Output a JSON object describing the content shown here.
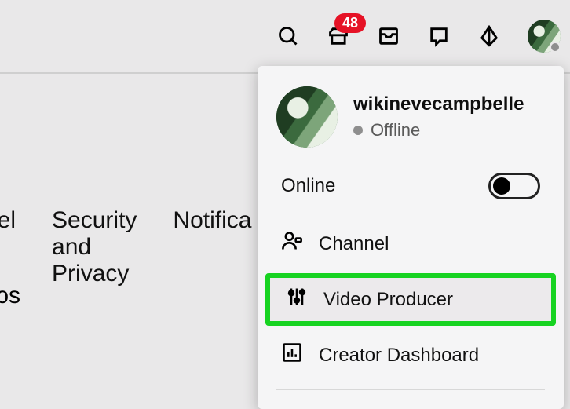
{
  "topbar": {
    "notification_badge": "48"
  },
  "bg_tabs": {
    "t0": "nel",
    "t1": "Security\nand\nPrivacy",
    "t2": "Notifica",
    "t3": "ɔs"
  },
  "menu": {
    "username": "wikinevecampbelle",
    "status": "Offline",
    "online_label": "Online",
    "items": {
      "channel": "Channel",
      "video_producer": "Video Producer",
      "creator_dashboard": "Creator Dashboard"
    }
  }
}
